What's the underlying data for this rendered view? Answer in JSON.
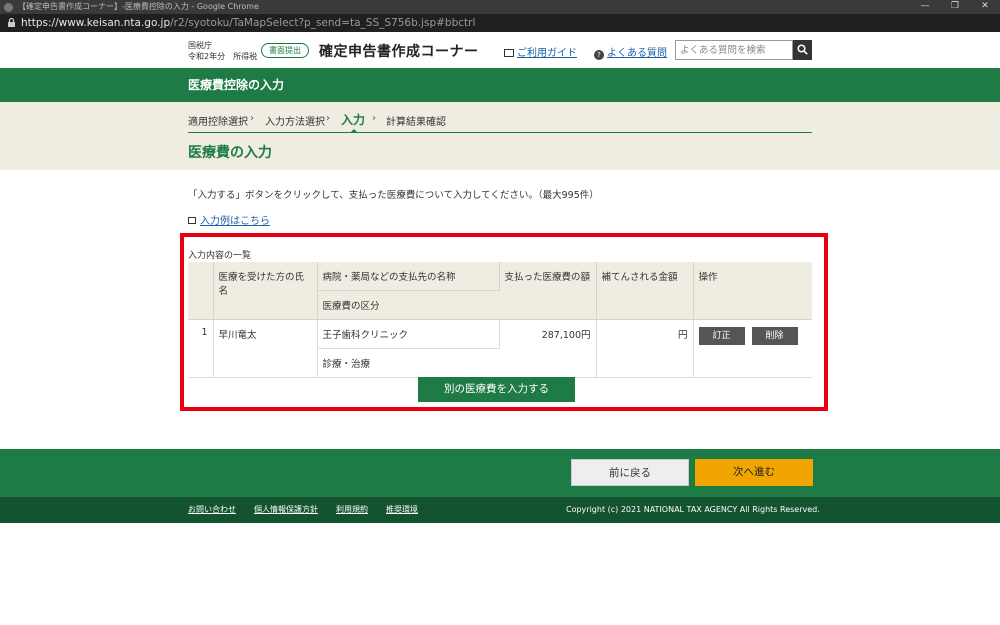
{
  "browser": {
    "title": "【確定申告書作成コーナー】-医療費控除の入力 - Google Chrome",
    "url_host": "https://www.keisan.nta.go.jp",
    "url_path": "/r2/syotoku/TaMapSelect?p_send=ta_SS_S756b.jsp#bbctrl"
  },
  "header": {
    "agency": "国税庁",
    "year_line": "令和2年分　所得税",
    "submit_badge": "書面提出",
    "site_title": "確定申告書作成コーナー",
    "guide_link": "ご利用ガイド",
    "faq_link": "よくある質問",
    "search_placeholder": "よくある質問を検索"
  },
  "section_title": "医療費控除の入力",
  "steps": [
    "適用控除選択",
    "入力方法選択",
    "入力",
    "計算結果確認"
  ],
  "current_step": "入力",
  "page_title": "医療費の入力",
  "instruction": "「入力する」ボタンをクリックして、支払った医療費について入力してください。（最大995件）",
  "example_link": "入力例はこちら",
  "list": {
    "caption": "入力内容の一覧",
    "headers": {
      "name": "医療を受けた方の氏名",
      "payee": "病院・薬局などの支払先の名称",
      "category": "医療費の区分",
      "paid": "支払った医療費の額",
      "reimbursed": "補てんされる金額",
      "ops": "操作"
    },
    "rows": [
      {
        "no": "1",
        "name": "早川竜太",
        "payee": "王子歯科クリニック",
        "category": "診療・治療",
        "paid": "287,100円",
        "reimbursed": "円",
        "edit_label": "訂正",
        "delete_label": "削除"
      }
    ],
    "add_button": "別の医療費を入力する"
  },
  "nav": {
    "back": "前に戻る",
    "next": "次へ進む"
  },
  "footer": {
    "links": [
      "お問い合わせ",
      "個人情報保護方針",
      "利用規約",
      "推奨環境"
    ],
    "copyright": "Copyright (c) 2021 NATIONAL TAX AGENCY All Rights Reserved."
  },
  "colors": {
    "brand_green": "#1e7b45",
    "dark_green": "#14532f",
    "highlight_red": "#e60012",
    "next_orange": "#f0a500",
    "beige": "#efede2"
  }
}
